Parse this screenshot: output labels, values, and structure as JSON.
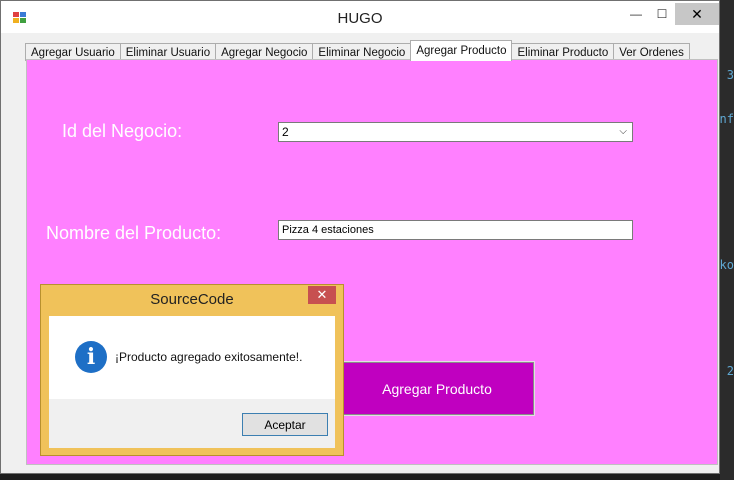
{
  "window": {
    "title": "HUGO",
    "controls": {
      "minimize": "—",
      "maximize": "☐",
      "close": "✕"
    }
  },
  "tabs": [
    {
      "label": "Agregar Usuario"
    },
    {
      "label": "Eliminar Usuario"
    },
    {
      "label": "Agregar Negocio"
    },
    {
      "label": "Eliminar Negocio"
    },
    {
      "label": "Agregar Producto",
      "active": true
    },
    {
      "label": "Eliminar Producto"
    },
    {
      "label": "Ver Ordenes"
    }
  ],
  "form": {
    "negocio_label": "Id del Negocio:",
    "negocio_value": "2",
    "producto_label": "Nombre del Producto:",
    "producto_value": "Pizza 4 estaciones",
    "submit_label": "Agregar Producto"
  },
  "dialog": {
    "title": "SourceCode",
    "close": "✕",
    "message": "¡Producto agregado exitosamente!.",
    "ok_label": "Aceptar",
    "icon": "info-icon"
  },
  "background": {
    "glyphs": [
      "3",
      "nf",
      "ko",
      "0 2"
    ]
  },
  "colors": {
    "panel": "#ff80ff",
    "button": "#c000c0",
    "dialog_frame": "#f0c25a",
    "info": "#1e6fc6"
  }
}
